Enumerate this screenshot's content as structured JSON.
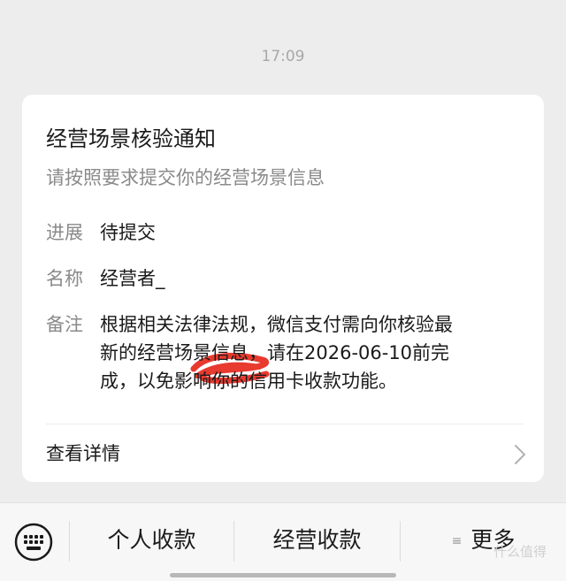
{
  "timestamp": "17:09",
  "card": {
    "title": "经营场景核验通知",
    "subtitle": "请按照要求提交你的经营场景信息",
    "rows": [
      {
        "label": "进展",
        "value": "待提交"
      },
      {
        "label": "名称",
        "value": "经营者_"
      },
      {
        "label": "备注",
        "value_lines": [
          "根据相关法律法规，微信支付需向你核验最",
          "新的经营场景信息，请在2026-06-10前完",
          "成，以免影响你的信用卡收款功能。"
        ]
      }
    ],
    "details_label": "查看详情"
  },
  "bottom_menu": {
    "keyboard_icon": "keyboard-icon",
    "items": [
      "个人收款",
      "经营收款",
      "更多"
    ]
  },
  "watermark": "什么值得",
  "colors": {
    "background": "#ededed",
    "card": "#ffffff",
    "secondary_text": "#8a8a8a",
    "redaction": "#e83a2f"
  }
}
